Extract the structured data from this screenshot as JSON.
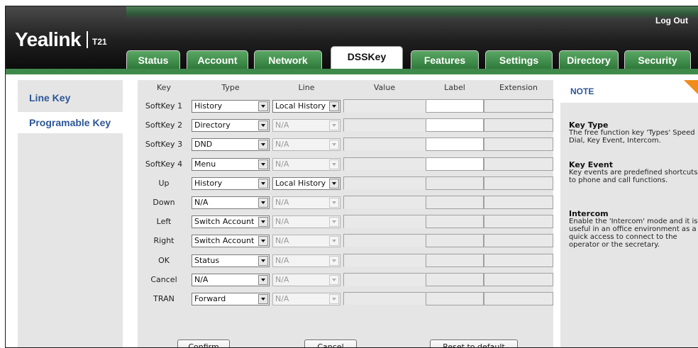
{
  "header": {
    "logo_text": "Yealink",
    "model": "T21",
    "logout_label": "Log Out",
    "accent_color": "#3f8a4b"
  },
  "tabs": [
    {
      "label": "Status",
      "active": false
    },
    {
      "label": "Account",
      "active": false
    },
    {
      "label": "Network",
      "active": false
    },
    {
      "label": "DSSKey",
      "active": true
    },
    {
      "label": "Features",
      "active": false
    },
    {
      "label": "Settings",
      "active": false
    },
    {
      "label": "Directory",
      "active": false
    },
    {
      "label": "Security",
      "active": false
    }
  ],
  "sidebar": {
    "items": [
      {
        "label": "Line Key",
        "selected": false
      },
      {
        "label": "Programable Key",
        "selected": true
      }
    ]
  },
  "table": {
    "headers": {
      "key": "Key",
      "type": "Type",
      "line": "Line",
      "value": "Value",
      "label": "Label",
      "extension": "Extension"
    },
    "rows": [
      {
        "key": "SoftKey 1",
        "type": "History",
        "line": "Local History",
        "line_enabled": true,
        "label_enabled": true
      },
      {
        "key": "SoftKey 2",
        "type": "Directory",
        "line": "N/A",
        "line_enabled": false,
        "label_enabled": true
      },
      {
        "key": "SoftKey 3",
        "type": "DND",
        "line": "N/A",
        "line_enabled": false,
        "label_enabled": true
      },
      {
        "key": "SoftKey 4",
        "type": "Menu",
        "line": "N/A",
        "line_enabled": false,
        "label_enabled": true
      },
      {
        "key": "Up",
        "type": "History",
        "line": "Local History",
        "line_enabled": true,
        "label_enabled": false
      },
      {
        "key": "Down",
        "type": "N/A",
        "line": "N/A",
        "line_enabled": false,
        "label_enabled": false
      },
      {
        "key": "Left",
        "type": "Switch Account",
        "line": "N/A",
        "line_enabled": false,
        "label_enabled": false
      },
      {
        "key": "Right",
        "type": "Switch Account",
        "line": "N/A",
        "line_enabled": false,
        "label_enabled": false
      },
      {
        "key": "OK",
        "type": "Status",
        "line": "N/A",
        "line_enabled": false,
        "label_enabled": false
      },
      {
        "key": "Cancel",
        "type": "N/A",
        "line": "N/A",
        "line_enabled": false,
        "label_enabled": false
      },
      {
        "key": "TRAN",
        "type": "Forward",
        "line": "N/A",
        "line_enabled": false,
        "label_enabled": false
      }
    ]
  },
  "buttons": {
    "confirm": "Confirm",
    "cancel": "Cancel",
    "reset": "Reset to default"
  },
  "note": {
    "title": "NOTE",
    "sections": [
      {
        "title": "Key Type",
        "text": "The free function key 'Types' Speed Dial, Key Event, Intercom."
      },
      {
        "title": "Key Event",
        "text": "Key events are predefined shortcuts to phone and call functions."
      },
      {
        "title": "Intercom",
        "text": "Enable the 'Intercom' mode and it is useful in an office environment as a quick access to connect to the operator or the secretary."
      }
    ]
  }
}
